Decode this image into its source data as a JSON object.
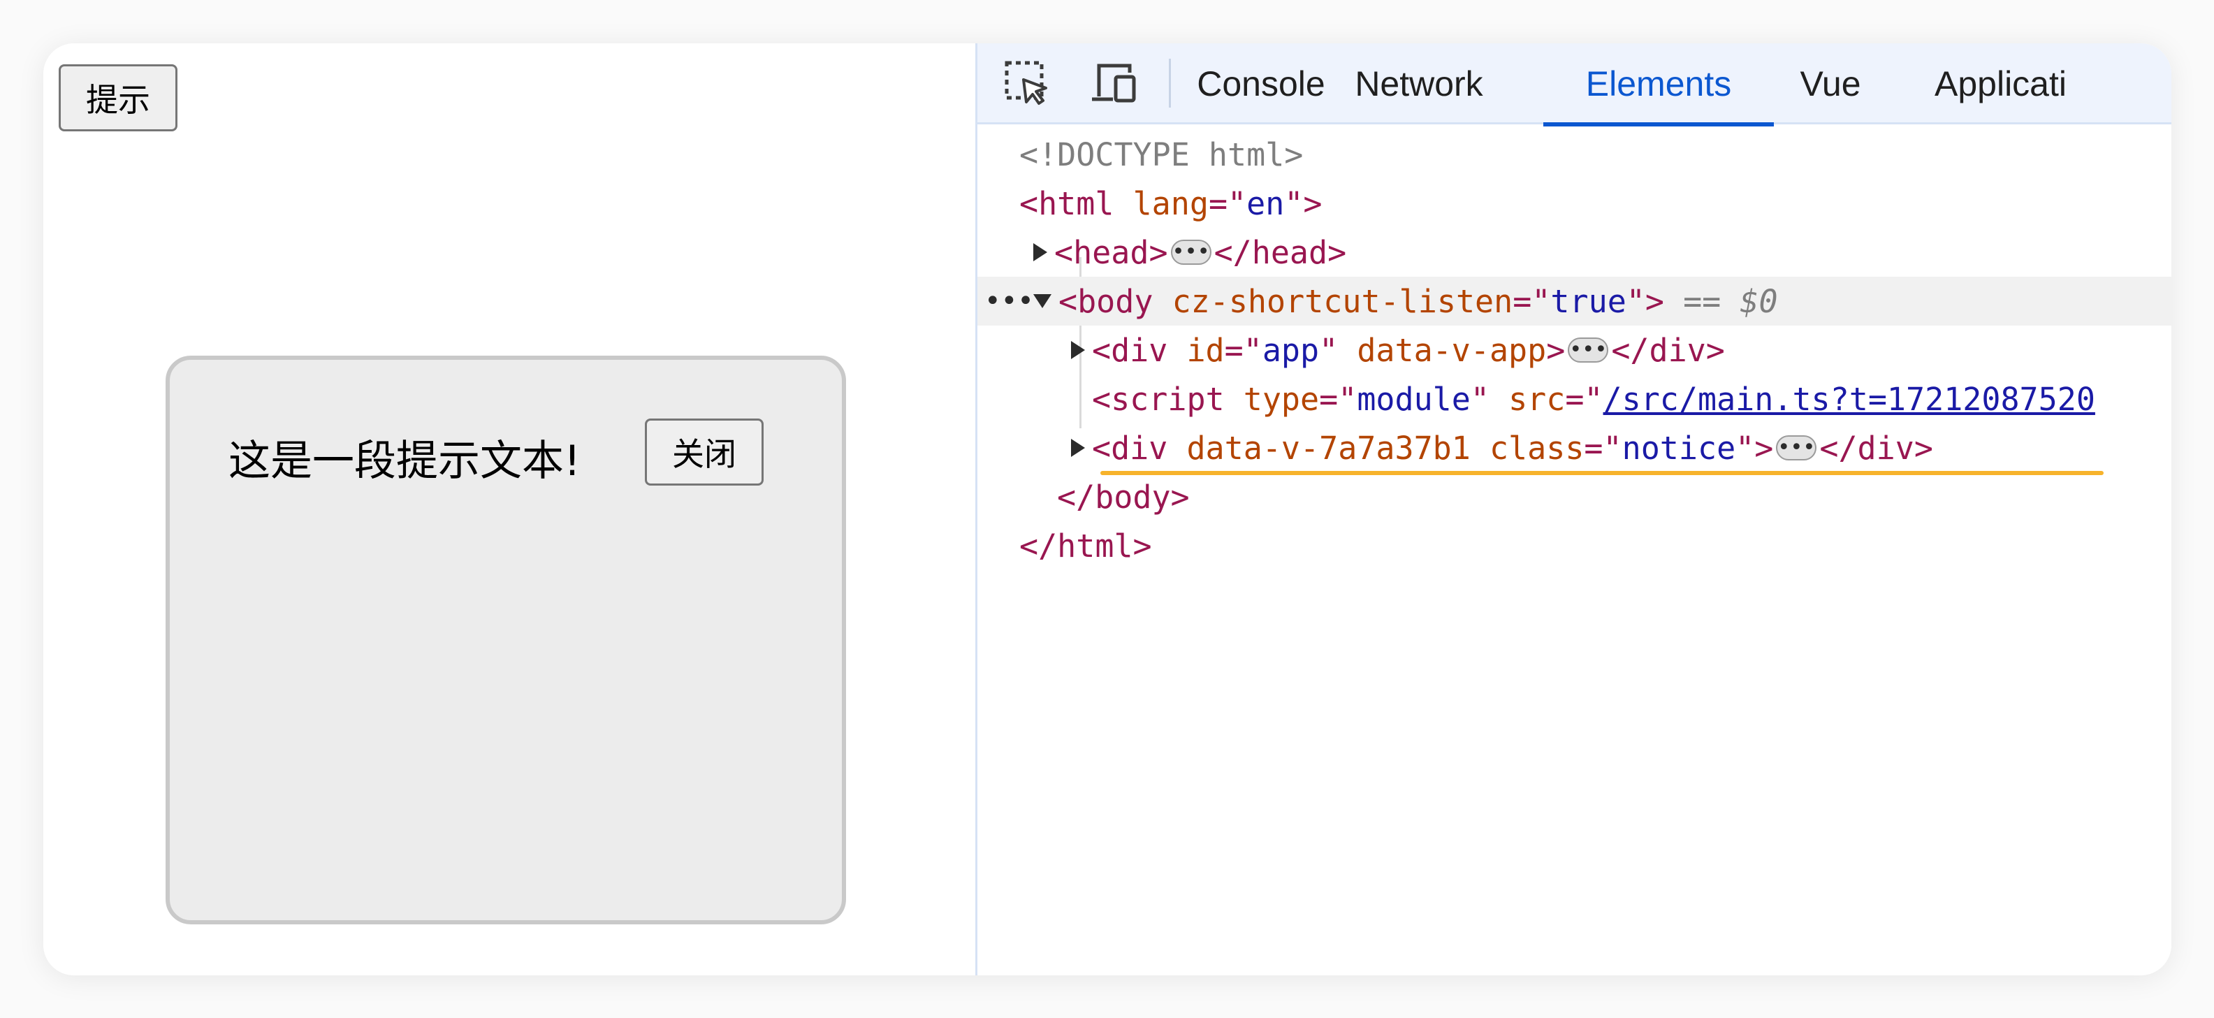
{
  "page": {
    "hint_button": "提示",
    "notice_text": "这是一段提示文本!",
    "close_button": "关闭"
  },
  "devtools": {
    "tabs": [
      {
        "label": "Console",
        "active": false
      },
      {
        "label": "Network",
        "active": false
      },
      {
        "label": "Elements",
        "active": true
      },
      {
        "label": "Vue",
        "active": false
      },
      {
        "label": "Applicati",
        "active": false
      }
    ],
    "icons": [
      "element-picker-icon",
      "device-toolbar-icon"
    ],
    "colors": {
      "accent": "#0b57d0",
      "tag": "#991650",
      "attr": "#b34400",
      "value": "#1a1aa6",
      "highlight": "#f7b32b"
    },
    "dom": {
      "doctype": "<!DOCTYPE html>",
      "html_open_tag": "<html",
      "html_lang_attr": "lang",
      "html_lang_value": "en",
      "html_open_close": ">",
      "head_open": "<head>",
      "head_close": "</head>",
      "body_open_tag": "<body",
      "body_attr": "cz-shortcut-listen",
      "body_attr_value": "true",
      "body_open_close": ">",
      "body_eq": "== $0",
      "div_app_open": "<div",
      "div_app_id_attr": "id",
      "div_app_id_value": "app",
      "div_app_data_attr": "data-v-app",
      "div_app_open_close": ">",
      "div_close": "</div>",
      "script_open": "<script",
      "script_type_attr": "type",
      "script_type_value": "module",
      "script_src_attr": "src",
      "script_src_value": "/src/main.ts?t=17212087520",
      "div_notice_open": "<div",
      "div_notice_data_attr": "data-v-7a7a37b1",
      "div_notice_class_attr": "class",
      "div_notice_class_value": "notice",
      "div_notice_open_close": ">",
      "body_close": "</body>",
      "html_close": "</html>",
      "ellipsis": "•••",
      "gutter_dots": "•••"
    }
  }
}
